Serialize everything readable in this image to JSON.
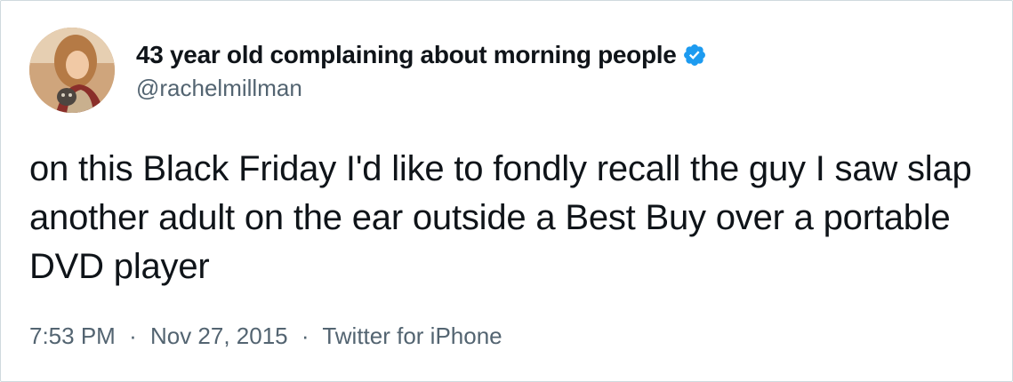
{
  "tweet": {
    "author": {
      "display_name": "43 year old complaining about morning people",
      "handle": "@rachelmillman",
      "verified": true,
      "verified_icon": "verified-badge-icon",
      "avatar": "user-avatar-photo"
    },
    "text": "on this Black Friday I'd like to fondly recall the guy I saw slap another adult on the ear outside a Best Buy over a portable DVD player",
    "time": "7:53 PM",
    "separator": "·",
    "date": "Nov 27, 2015",
    "source": "Twitter for iPhone"
  },
  "colors": {
    "text_primary": "#0f1419",
    "text_secondary": "#536471",
    "verified_blue": "#1d9bf0",
    "border": "#cfd9de"
  }
}
